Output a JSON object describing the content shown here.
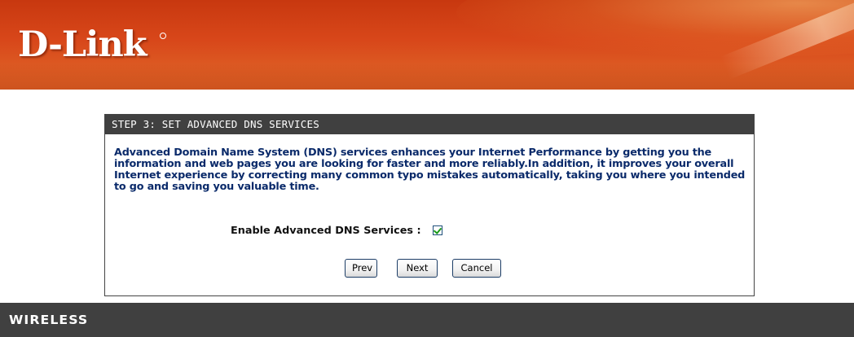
{
  "brand": {
    "logo_text": "D-Link"
  },
  "wizard": {
    "title": "STEP 3: SET ADVANCED DNS SERVICES",
    "description": "Advanced Domain Name System (DNS) services enhances your Internet Performance by getting you the information and web pages you are looking for faster and more reliably.In addition, it improves your overall Internet experience by correcting many common typo mistakes automatically, taking you where you intended to go and saving you valuable time.",
    "enable_label": "Enable Advanced DNS Services :",
    "enable_checked": true,
    "buttons": {
      "prev": "Prev",
      "next": "Next",
      "cancel": "Cancel"
    }
  },
  "footer": {
    "label": "WIRELESS"
  },
  "colors": {
    "header_orange": "#d8471a",
    "dark_bar": "#404040",
    "description_blue": "#0a2a6a",
    "checkmark_green": "#1a9a1a"
  }
}
